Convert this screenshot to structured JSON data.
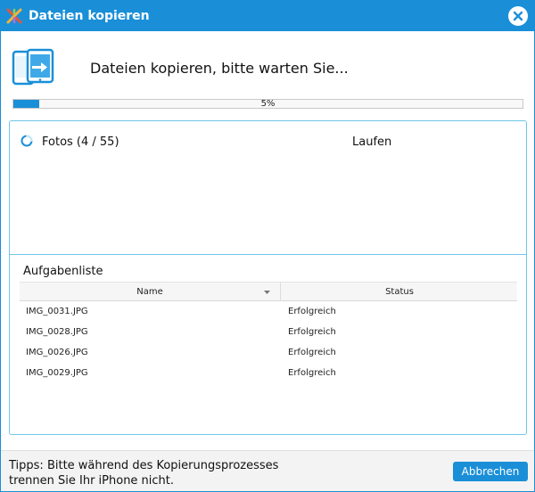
{
  "window": {
    "title": "Dateien kopieren",
    "app_icon": "app-logo-icon",
    "close_icon": "close-icon"
  },
  "header": {
    "icon": "copy-devices-icon",
    "message": "Dateien kopieren, bitte warten Sie..."
  },
  "progress": {
    "value": 5,
    "label": "5%"
  },
  "current_task": {
    "icon": "spinner-icon",
    "name": "Fotos (4 / 55)",
    "status": "Laufen"
  },
  "task_list": {
    "heading": "Aufgabenliste",
    "columns": [
      "Name",
      "Status"
    ],
    "rows": [
      {
        "name": "IMG_0031.JPG",
        "status": "Erfolgreich"
      },
      {
        "name": "IMG_0028.JPG",
        "status": "Erfolgreich"
      },
      {
        "name": "IMG_0026.JPG",
        "status": "Erfolgreich"
      },
      {
        "name": "IMG_0029.JPG",
        "status": "Erfolgreich"
      }
    ]
  },
  "footer": {
    "tip_line1": "Tipps: Bitte während des Kopierungsprozesses",
    "tip_line2": "trennen Sie Ihr iPhone nicht.",
    "cancel_label": "Abbrechen"
  },
  "colors": {
    "accent": "#1a8fd8",
    "panel_border": "#6fc6ea"
  }
}
